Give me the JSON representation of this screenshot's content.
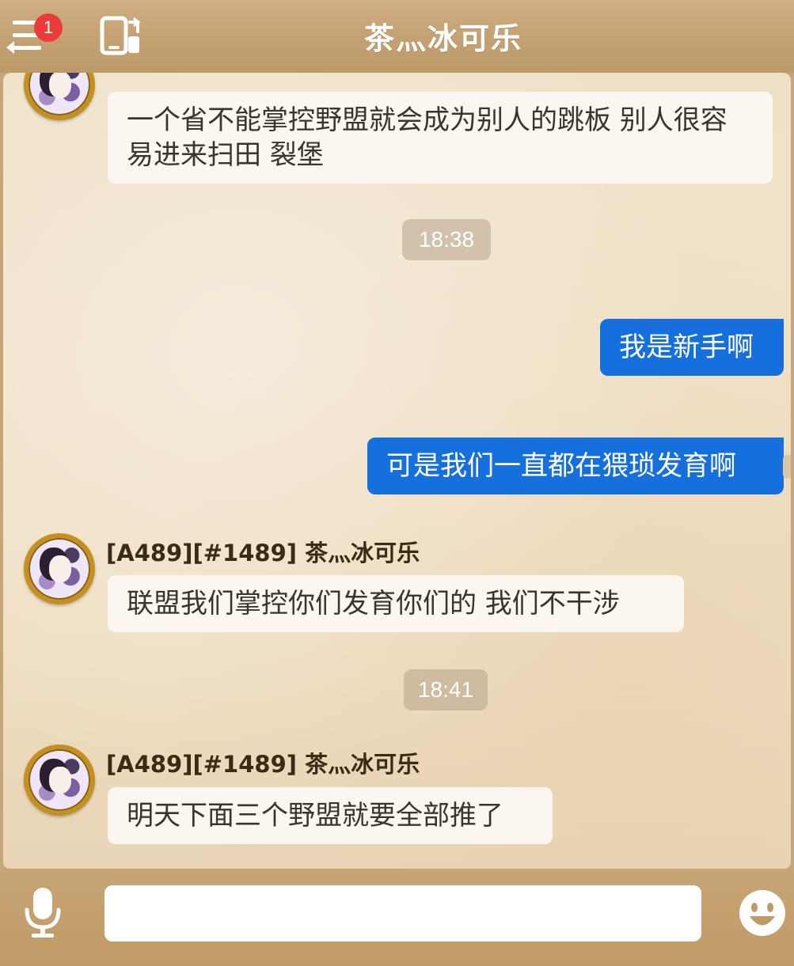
{
  "header": {
    "menu_icon": "menu-switch-icon",
    "notification_count": "1",
    "device_icon": "phone-switch-icon",
    "title": "茶灬冰可乐"
  },
  "messages": [
    {
      "type": "incoming",
      "avatar": "anime-avatar",
      "text": "一个省不能掌控野盟就会成为别人的跳板  别人很容易进来扫田  裂堡"
    },
    {
      "type": "timestamp",
      "text": "18:38"
    },
    {
      "type": "outgoing",
      "text": "我是新手啊"
    },
    {
      "type": "outgoing",
      "text": "可是我们一直都在猥琐发育啊"
    },
    {
      "type": "incoming",
      "avatar": "anime-avatar",
      "sender": "[A489][#1489] 茶灬冰可乐",
      "text": "联盟我们掌控你们发育你们的  我们不干涉"
    },
    {
      "type": "timestamp",
      "text": "18:41"
    },
    {
      "type": "incoming",
      "avatar": "anime-avatar",
      "sender": "[A489][#1489] 茶灬冰可乐",
      "text": "明天下面三个野盟就要全部推了"
    }
  ],
  "composer": {
    "mic_icon": "microphone-icon",
    "input_value": "",
    "emoji_icon": "smiley-face-icon"
  },
  "colors": {
    "outgoing_bubble": "#1570dd",
    "incoming_bubble": "#fbf6ef",
    "badge": "#ec3b3b",
    "avatar_frame": "#c4901f"
  }
}
